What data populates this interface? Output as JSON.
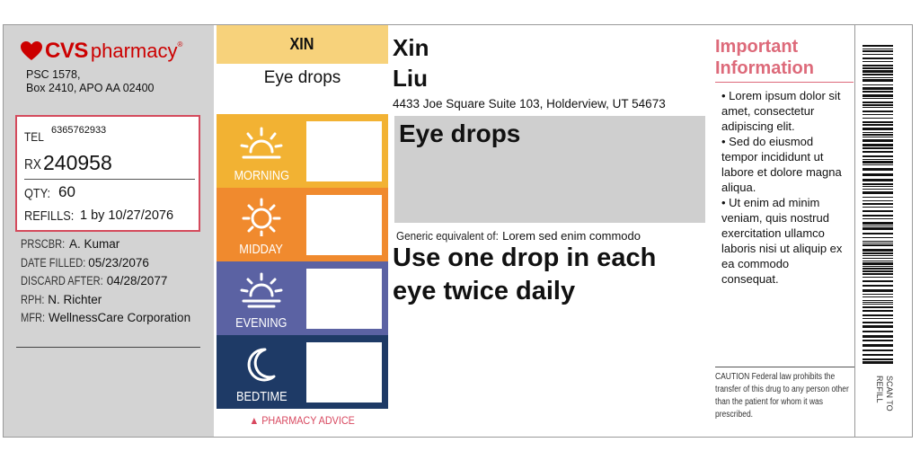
{
  "pharmacy": {
    "brand_cvs": "CVS",
    "brand_pharmacy": "pharmacy",
    "trademark": "®",
    "address_line1": "PSC 1578,",
    "address_line2": "Box 2410, APO AA 02400"
  },
  "rx": {
    "tel_label": "TEL",
    "tel_value": "6365762933",
    "rx_label": "RX",
    "rx_number": "240958",
    "qty_label": "QTY:",
    "qty_value": "60",
    "refills_label": "REFILLS:",
    "refills_value": "1 by 10/27/2076"
  },
  "details": [
    {
      "label": "PRSCBR:",
      "value": "A. Kumar"
    },
    {
      "label": "DATE FILLED:",
      "value": "05/23/2076"
    },
    {
      "label": "DISCARD AFTER:",
      "value": "04/28/2077"
    },
    {
      "label": "RPH:",
      "value": "N. Richter"
    },
    {
      "label": "MFR:",
      "value": "WellnessCare Corporation"
    }
  ],
  "schedule": {
    "patient_tag": "XIN",
    "drug_short": "Eye drops",
    "slots": [
      {
        "label": "MORNING",
        "color": "#f2b233",
        "icon": "sunrise-icon"
      },
      {
        "label": "MIDDAY",
        "color": "#f08a2e",
        "icon": "sun-icon"
      },
      {
        "label": "EVENING",
        "color": "#5b62a3",
        "icon": "sunset-icon"
      },
      {
        "label": "BEDTIME",
        "color": "#1e3a66",
        "icon": "moon-icon"
      }
    ],
    "advice": "▲ PHARMACY ADVICE"
  },
  "patient": {
    "first_name": "Xin",
    "last_name": "Liu",
    "address": "4433 Joe Square Suite 103, Holderview, UT 54673"
  },
  "drug": {
    "name": "Eye drops",
    "generic_label": "Generic equivalent of:",
    "generic_value": "Lorem sed enim commodo",
    "directions": "Use one drop in each eye twice daily"
  },
  "important": {
    "title_line1": "Important",
    "title_line2": "Information",
    "items": [
      "• Lorem ipsum dolor sit amet, consectetur adipiscing elit.",
      "• Sed do eiusmod tempor incididunt ut labore et dolore magna aliqua.",
      "• Ut enim ad minim veniam, quis nostrud exercitation ullamco laboris nisi ut aliquip ex ea commodo consequat."
    ],
    "caution": "CAUTION Federal law prohibits the transfer of this drug to any person other than the patient for whom it was prescribed."
  },
  "barcode": {
    "caption": "SCAN TO REFILL"
  },
  "colors": {
    "brand_red": "#cc0000",
    "accent_pink": "#dd6a7a",
    "tag_yellow": "#f7d27b"
  }
}
